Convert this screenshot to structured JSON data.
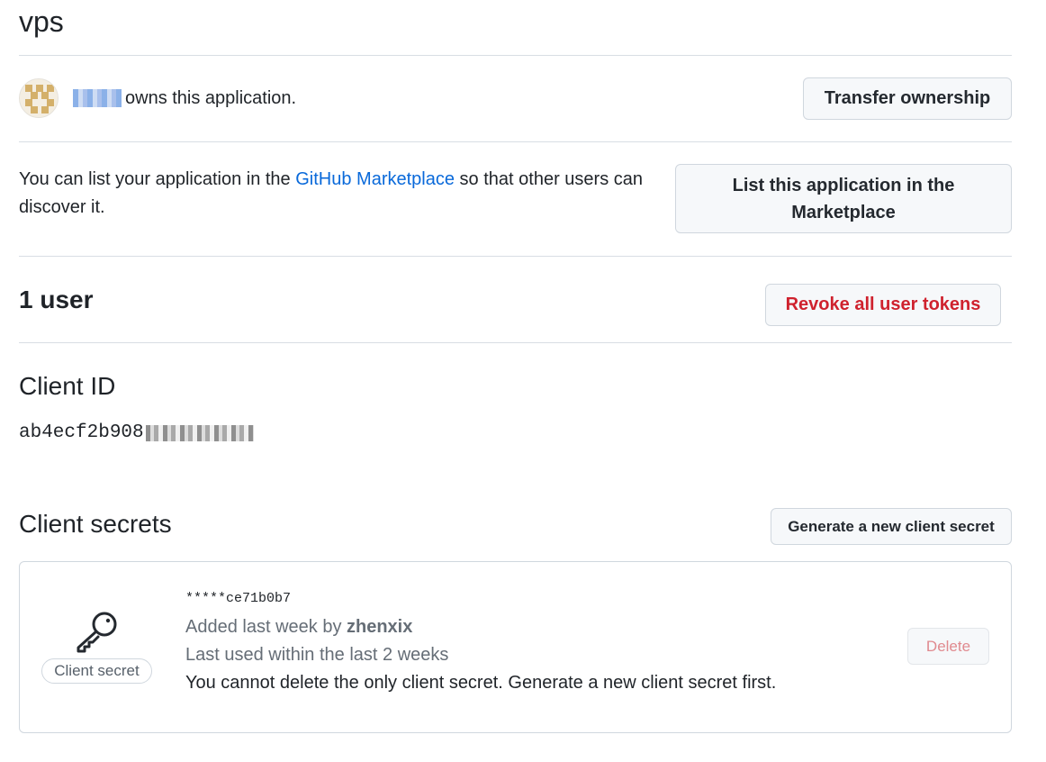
{
  "app": {
    "title": "vps"
  },
  "owner": {
    "text": "owns this application.",
    "transfer_label": "Transfer ownership"
  },
  "marketplace": {
    "text_before": "You can list your application in the ",
    "link_text": "GitHub Marketplace",
    "text_after": " so that other users can discover it.",
    "button_label": "List this application in the Marketplace"
  },
  "users": {
    "count": "1",
    "label": " user",
    "revoke_label": "Revoke all user tokens"
  },
  "client_id": {
    "title": "Client ID",
    "value_visible": "ab4ecf2b908"
  },
  "client_secrets": {
    "title": "Client secrets",
    "generate_label": "Generate a new client secret",
    "secret": {
      "badge": "Client secret",
      "masked": "*****ce71b0b7",
      "added_prefix": "Added last week by ",
      "added_by": "zhenxix",
      "last_used": "Last used within the last 2 weeks",
      "note": "You cannot delete the only client secret. Generate a new client secret first.",
      "delete_label": "Delete"
    }
  },
  "colors": {
    "link": "#0969da",
    "danger": "#cf222e",
    "border": "#d0d7de",
    "muted": "#656d76"
  }
}
